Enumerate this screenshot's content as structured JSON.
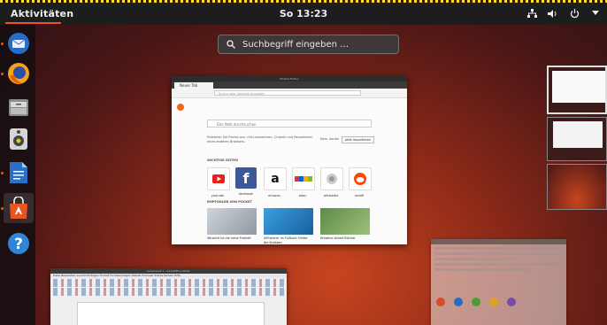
{
  "topbar": {
    "activities_label": "Aktivitäten",
    "clock": "So 13:23",
    "tray_icons": [
      "network-icon",
      "volume-icon",
      "power-icon",
      "chevron-down-icon"
    ]
  },
  "search": {
    "placeholder": "Suchbegriff eingeben …"
  },
  "dock": {
    "items": [
      {
        "name": "thunderbird",
        "icon": "thunderbird-icon",
        "running": true
      },
      {
        "name": "firefox",
        "icon": "firefox-icon",
        "running": true
      },
      {
        "name": "files",
        "icon": "files-icon",
        "running": false
      },
      {
        "name": "rhythmbox",
        "icon": "speaker-icon",
        "running": false
      },
      {
        "name": "libreoffice-writer",
        "icon": "writer-icon",
        "running": true
      },
      {
        "name": "software",
        "icon": "bag-icon",
        "running": true
      },
      {
        "name": "help",
        "icon": "help-icon",
        "running": false
      }
    ]
  },
  "firefox_window": {
    "title": "Mozilla Firefox",
    "tab_label": "Neuer Tab",
    "url_placeholder": "Suche oder Adresse eingeben",
    "page_search_placeholder": "Das Web durchsuchen",
    "note": "Probieren Sie Firefox aus, mit Lesezeichen, Chronik und Passwörtern eines anderen Browsers.",
    "btn_no_thanks": "Nein, danke",
    "btn_import": "Jetzt importieren",
    "top_sites_heading": "WICHTIGE SEITEN",
    "top_sites": [
      "youtube",
      "facebook",
      "amazon",
      "ebay",
      "wikipedia",
      "reddit"
    ],
    "pocket_heading": "EMPFOHLEN VON POCKET",
    "stories": [
      {
        "text": "Verzicht ist die neue Freiheit"
      },
      {
        "text": "Influencer im Fußball: Hinter die Kulissen"
      },
      {
        "text": "Kreative Arbeit Bücher"
      }
    ]
  },
  "writer_window": {
    "title": "Unbenannt 1 - LibreOffice Writer",
    "menu": "Datei  Bearbeiten  Ansicht  Einfügen  Format  Formatvorlagen  Tabelle  Formular  Extras  Fenster  Hilfe"
  },
  "colors": {
    "accent": "#e95420",
    "topbar": "#1d1d1d",
    "dock": "#140e10"
  }
}
